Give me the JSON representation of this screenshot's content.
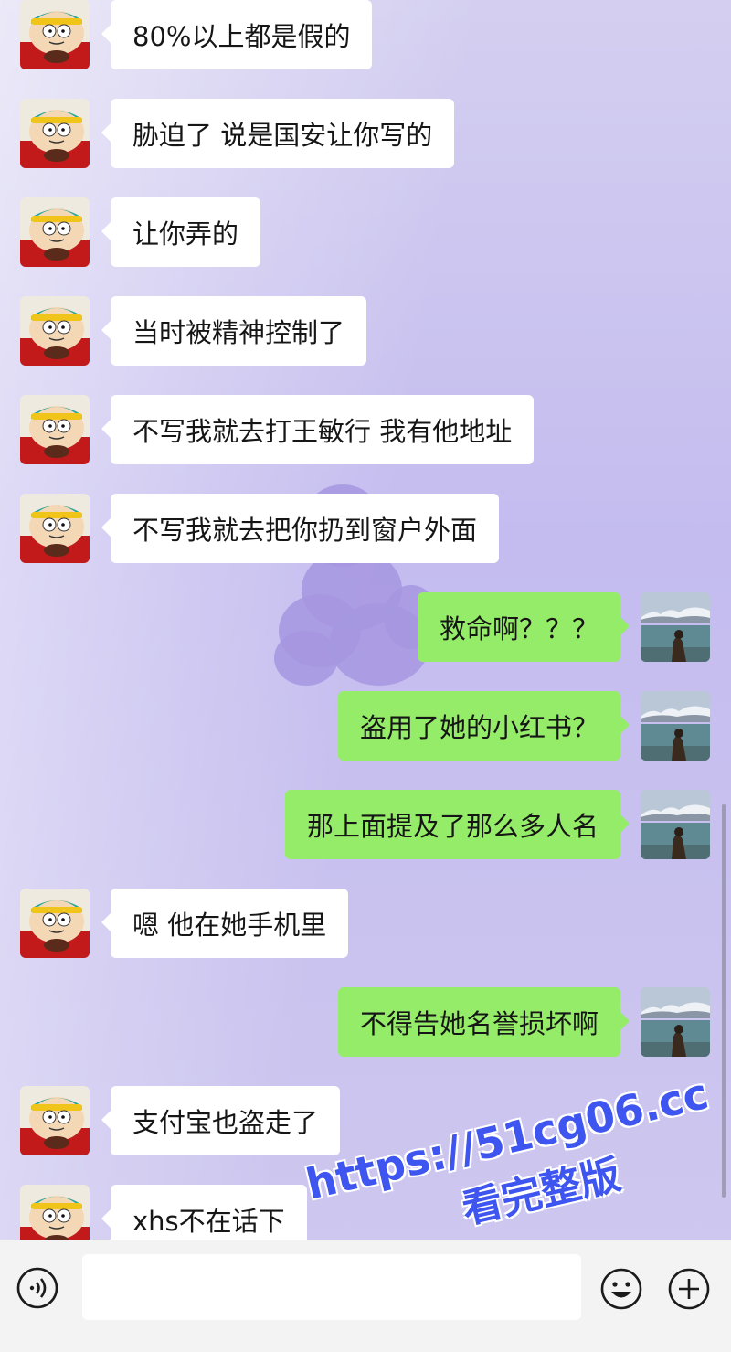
{
  "messages": [
    {
      "side": "in",
      "text": "80%以上都是假的"
    },
    {
      "side": "in",
      "text": "胁迫了 说是国安让你写的"
    },
    {
      "side": "in",
      "text": "让你弄的"
    },
    {
      "side": "in",
      "text": "当时被精神控制了"
    },
    {
      "side": "in",
      "text": "不写我就去打王敏行 我有他地址"
    },
    {
      "side": "in",
      "text": "不写我就去把你扔到窗户外面"
    },
    {
      "side": "out",
      "text": "救命啊？？？"
    },
    {
      "side": "out",
      "text": "盗用了她的小红书？"
    },
    {
      "side": "out",
      "text": "那上面提及了那么多人名"
    },
    {
      "side": "in",
      "text": "嗯 他在她手机里"
    },
    {
      "side": "out",
      "text": "不得告她名誉损坏啊"
    },
    {
      "side": "in",
      "text": "支付宝也盗走了"
    },
    {
      "side": "in",
      "text": "xhs不在话下"
    }
  ],
  "icons": {
    "incoming_avatar": "cartoon-avatar-icon",
    "outgoing_avatar": "landscape-avatar-icon",
    "voice": "voice-icon",
    "emoji": "emoji-icon",
    "plus": "plus-icon"
  },
  "colors": {
    "incoming_bubble": "#ffffff",
    "outgoing_bubble": "#95ec69",
    "watermark": "#3e55f0"
  },
  "watermark": {
    "line1": "https://51cg06.cc",
    "line2": "看完整版"
  }
}
